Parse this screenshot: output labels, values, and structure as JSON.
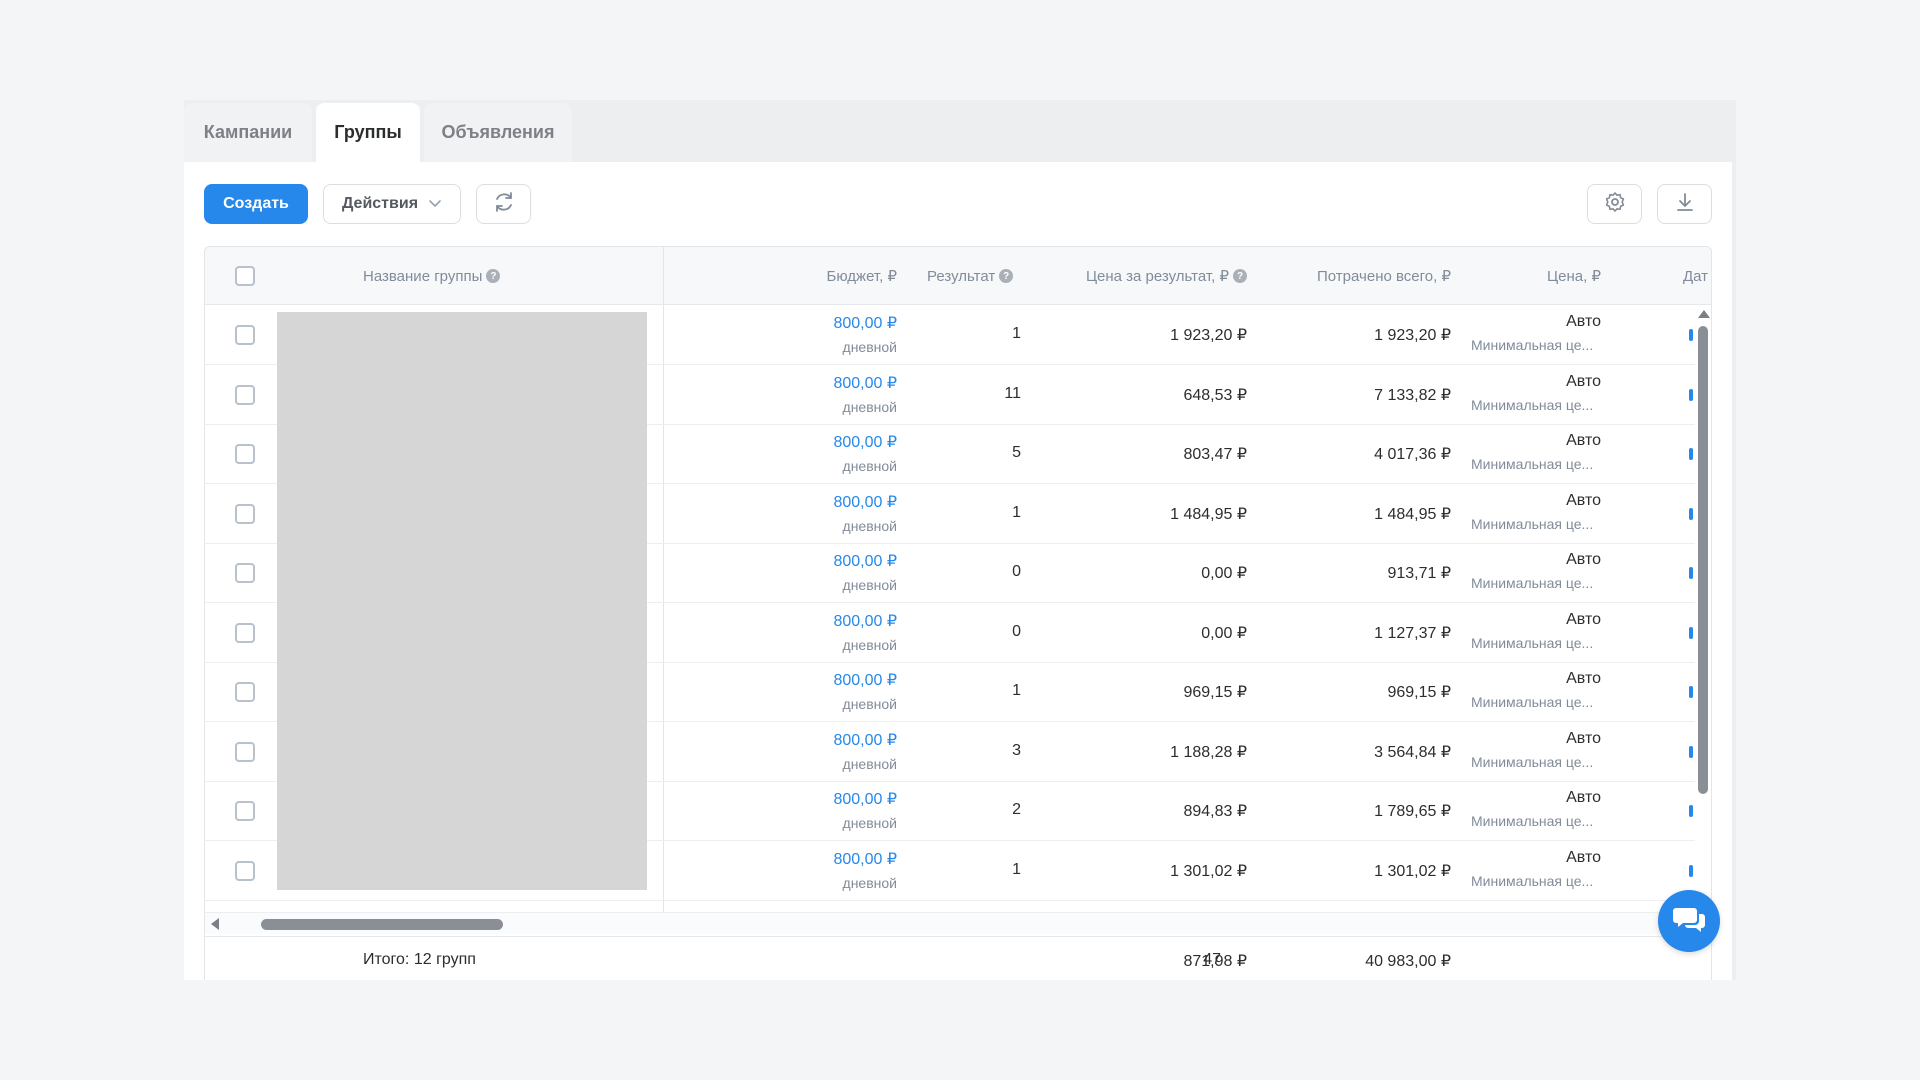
{
  "tabs": [
    {
      "label": "Кампании",
      "active": false
    },
    {
      "label": "Группы",
      "active": true
    },
    {
      "label": "Объявления",
      "active": false
    }
  ],
  "toolbar": {
    "create_label": "Создать",
    "actions_label": "Действия",
    "accent_color": "#2688eb"
  },
  "table": {
    "columns": {
      "name": "Название группы",
      "budget": "Бюджет, ₽",
      "result": "Результат",
      "cost_per_result": "Цена за результат, ₽",
      "spent_total": "Потрачено всего, ₽",
      "price": "Цена, ₽",
      "date_cut": "Дат"
    },
    "rows": [
      {
        "budget": "800,00 ₽",
        "budget_type": "дневной",
        "result": "1",
        "cpr": "1 923,20 ₽",
        "spent": "1 923,20 ₽",
        "price": "Авто",
        "price_sub": "Минимальная це..."
      },
      {
        "budget": "800,00 ₽",
        "budget_type": "дневной",
        "result": "11",
        "cpr": "648,53 ₽",
        "spent": "7 133,82 ₽",
        "price": "Авто",
        "price_sub": "Минимальная це..."
      },
      {
        "budget": "800,00 ₽",
        "budget_type": "дневной",
        "result": "5",
        "cpr": "803,47 ₽",
        "spent": "4 017,36 ₽",
        "price": "Авто",
        "price_sub": "Минимальная це..."
      },
      {
        "budget": "800,00 ₽",
        "budget_type": "дневной",
        "result": "1",
        "cpr": "1 484,95 ₽",
        "spent": "1 484,95 ₽",
        "price": "Авто",
        "price_sub": "Минимальная це..."
      },
      {
        "budget": "800,00 ₽",
        "budget_type": "дневной",
        "result": "0",
        "cpr": "0,00 ₽",
        "spent": "913,71 ₽",
        "price": "Авто",
        "price_sub": "Минимальная це..."
      },
      {
        "budget": "800,00 ₽",
        "budget_type": "дневной",
        "result": "0",
        "cpr": "0,00 ₽",
        "spent": "1 127,37 ₽",
        "price": "Авто",
        "price_sub": "Минимальная це..."
      },
      {
        "budget": "800,00 ₽",
        "budget_type": "дневной",
        "result": "1",
        "cpr": "969,15 ₽",
        "spent": "969,15 ₽",
        "price": "Авто",
        "price_sub": "Минимальная це..."
      },
      {
        "budget": "800,00 ₽",
        "budget_type": "дневной",
        "result": "3",
        "cpr": "1 188,28 ₽",
        "spent": "3 564,84 ₽",
        "price": "Авто",
        "price_sub": "Минимальная це..."
      },
      {
        "budget": "800,00 ₽",
        "budget_type": "дневной",
        "result": "2",
        "cpr": "894,83 ₽",
        "spent": "1 789,65 ₽",
        "price": "Авто",
        "price_sub": "Минимальная це..."
      },
      {
        "budget": "800,00 ₽",
        "budget_type": "дневной",
        "result": "1",
        "cpr": "1 301,02 ₽",
        "spent": "1 301,02 ₽",
        "price": "Авто",
        "price_sub": "Минимальная це..."
      }
    ],
    "footer": {
      "total_label": "Итого: 12 групп",
      "result": "47",
      "cpr": "871,98 ₽",
      "spent": "40 983,00 ₽"
    }
  },
  "icons": [
    "chevron-down-icon",
    "refresh-icon",
    "gear-icon",
    "download-icon",
    "question-icon",
    "chat-icon"
  ]
}
